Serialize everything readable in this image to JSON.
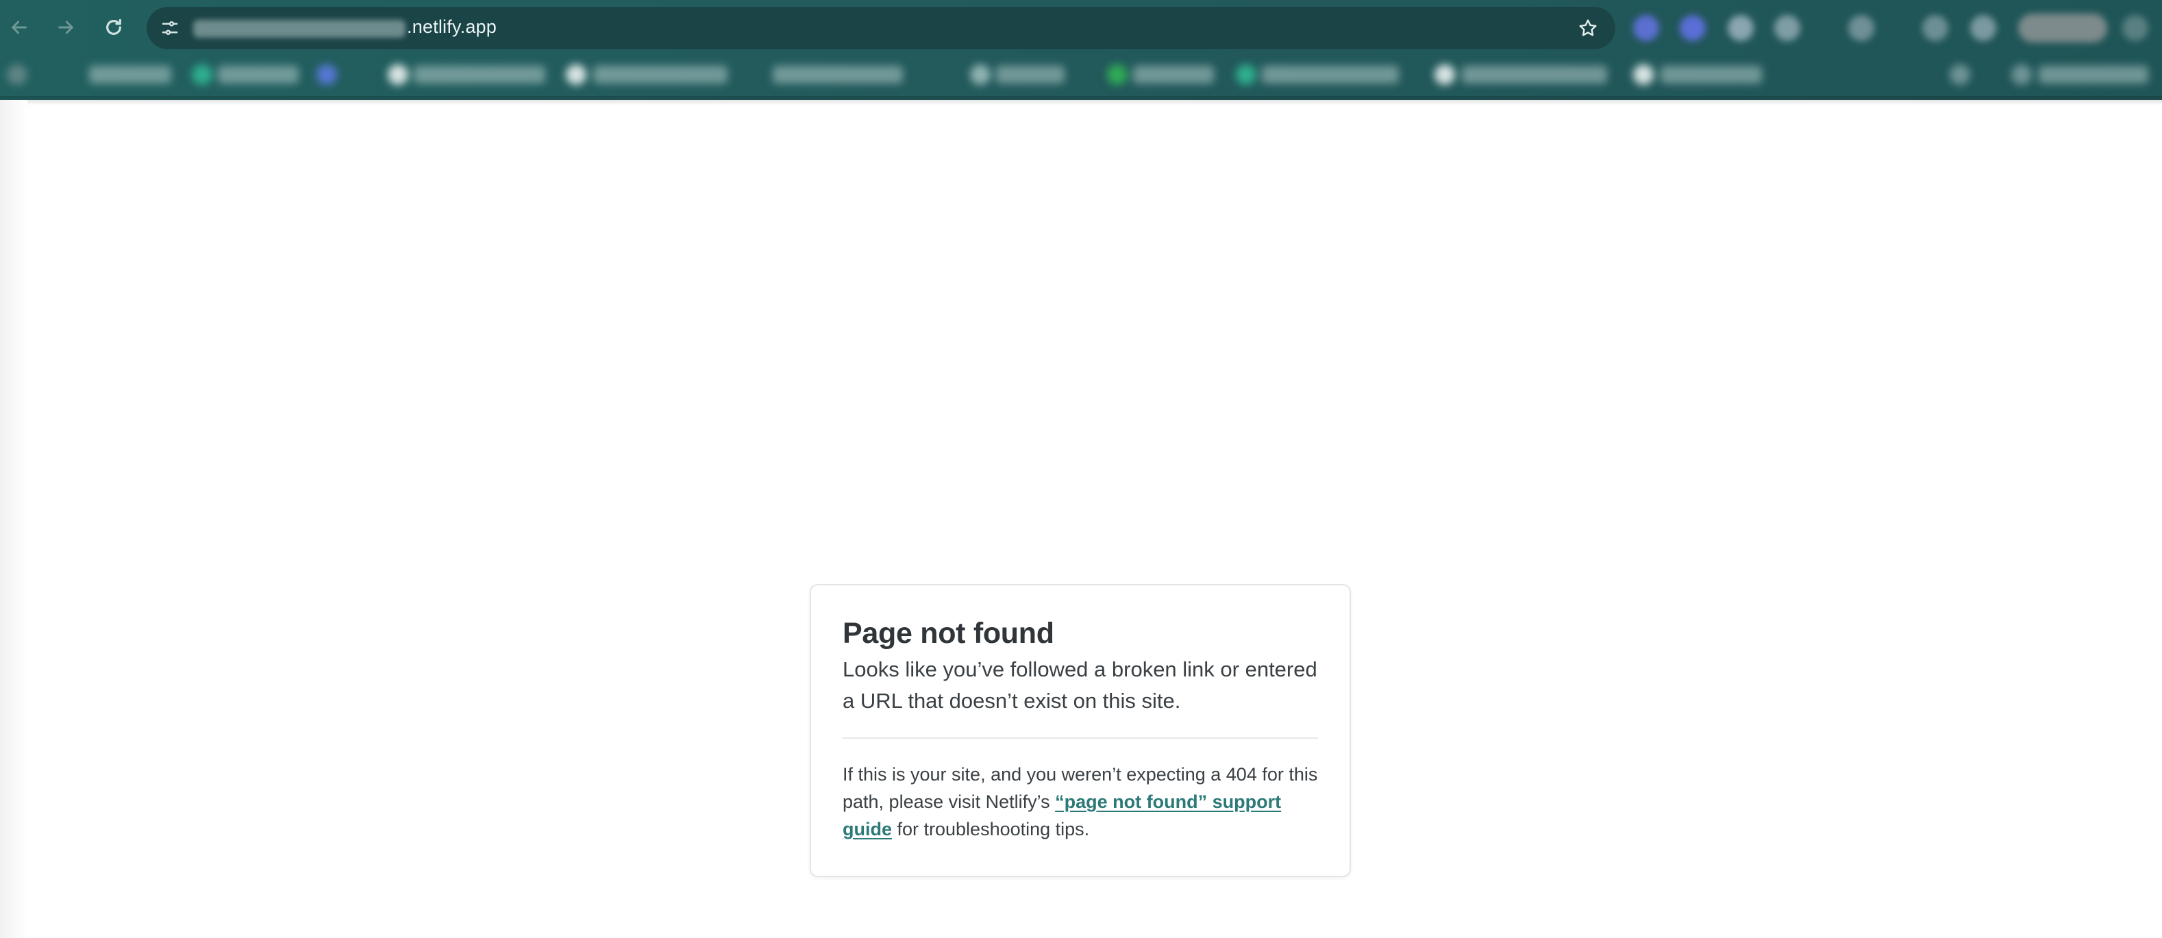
{
  "browser": {
    "url_visible_suffix": ".netlify.app",
    "back_icon": "arrow-left-icon",
    "forward_icon": "arrow-right-icon",
    "reload_icon": "reload-icon",
    "site_info_icon": "tune-icon",
    "bookmark_icon": "star-icon",
    "chrome_color": "#21605f"
  },
  "card": {
    "title": "Page not found",
    "lede": "Looks like you’ve followed a broken link or entered a URL that doesn’t exist on this site.",
    "help_prefix": "If this is your site, and you weren’t expecting a 404 for this path, please visit Netlify’s ",
    "help_link": "“page not found” support guide",
    "help_suffix": " for troubleshooting tips.",
    "link_color": "#2b7a78"
  }
}
